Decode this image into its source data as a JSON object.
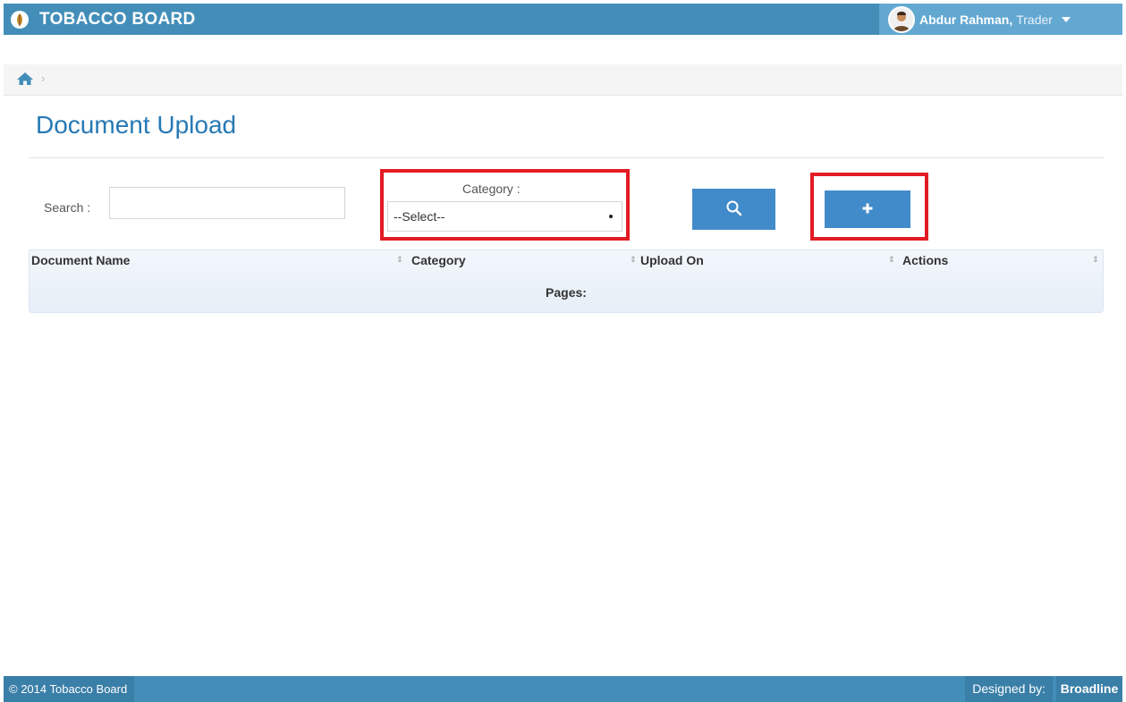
{
  "header": {
    "brand": "TOBACCO BOARD",
    "user_name": "Abdur Rahman,",
    "user_role": "Trader",
    "logo_icon": "tobacco-leaf-icon",
    "accent_color": "#438eb9"
  },
  "breadcrumb": {
    "home_icon": "home-icon",
    "separator": "›"
  },
  "page": {
    "title": "Document Upload"
  },
  "filter": {
    "search_label": "Search :",
    "search_value": "",
    "category_label": "Category :",
    "category_selected": "--Select--",
    "search_button_icon": "search-icon",
    "add_button_icon": "plus-icon",
    "highlight_color": "#e21b24"
  },
  "table": {
    "columns": [
      "Document Name",
      "Category",
      "Upload On",
      "Actions"
    ],
    "pages_label": "Pages:"
  },
  "footer": {
    "copyright": "© 2014 Tobacco Board",
    "designed_by_label": "Designed by:",
    "designer": "Broadline"
  }
}
